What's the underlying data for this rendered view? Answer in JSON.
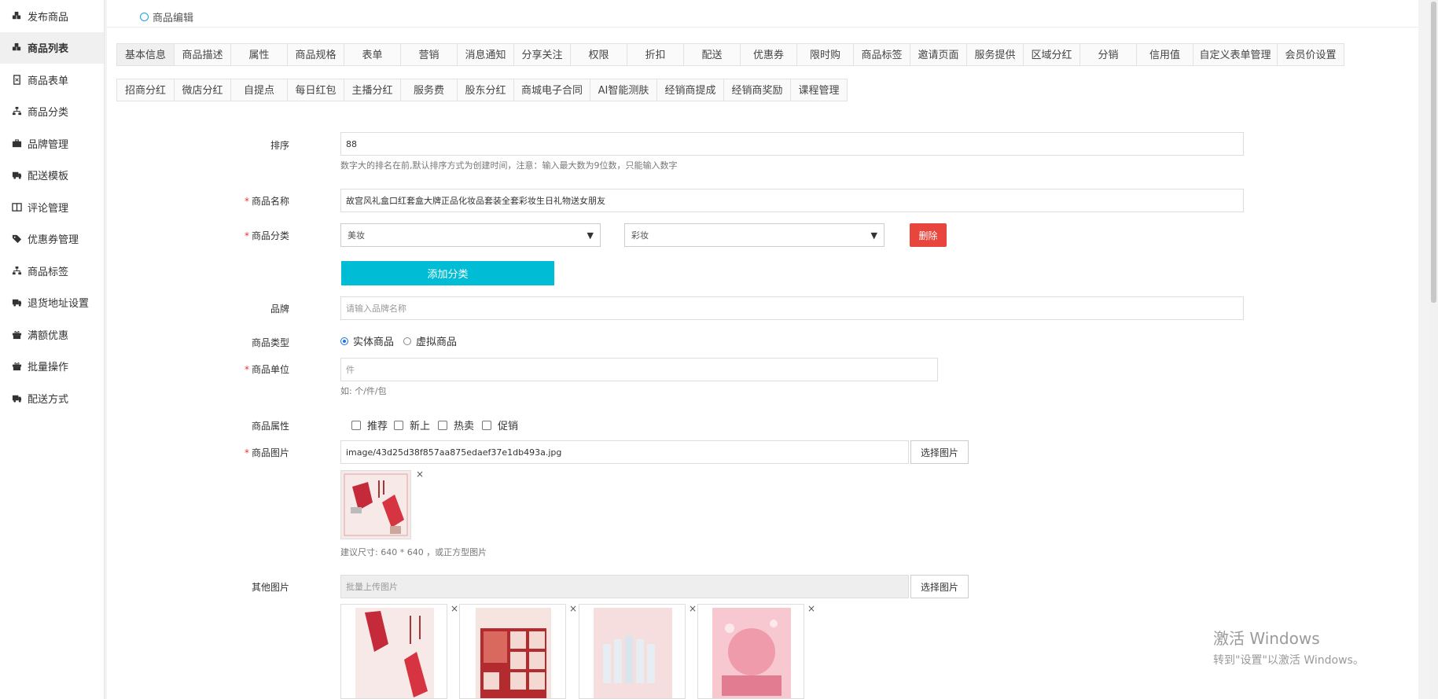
{
  "sidebar": {
    "items": [
      {
        "label": "发布商品",
        "icon": "cubes-icon"
      },
      {
        "label": "商品列表",
        "icon": "cubes-icon",
        "active": true
      },
      {
        "label": "商品表单",
        "icon": "file-icon"
      },
      {
        "label": "商品分类",
        "icon": "sitemap-icon"
      },
      {
        "label": "品牌管理",
        "icon": "briefcase-icon"
      },
      {
        "label": "配送模板",
        "icon": "truck-icon"
      },
      {
        "label": "评论管理",
        "icon": "columns-icon"
      },
      {
        "label": "优惠券管理",
        "icon": "tags-icon"
      },
      {
        "label": "商品标签",
        "icon": "sitemap-icon"
      },
      {
        "label": "退货地址设置",
        "icon": "truck-icon"
      },
      {
        "label": "满额优惠",
        "icon": "gift-icon"
      },
      {
        "label": "批量操作",
        "icon": "gift-icon"
      },
      {
        "label": "配送方式",
        "icon": "truck-icon"
      }
    ]
  },
  "breadcrumb": "商品编辑",
  "tabs_row1": [
    "基本信息",
    "商品描述",
    "属性",
    "商品规格",
    "表单",
    "营销",
    "消息通知",
    "分享关注",
    "权限",
    "折扣",
    "配送",
    "优惠券",
    "限时购",
    "商品标签",
    "邀请页面",
    "服务提供",
    "区域分红",
    "分销",
    "信用值",
    "自定义表单管理",
    "会员价设置"
  ],
  "tabs_row2": [
    "招商分红",
    "微店分红",
    "自提点",
    "每日红包",
    "主播分红",
    "服务费",
    "股东分红",
    "商城电子合同",
    "AI智能测肤",
    "经销商提成",
    "经销商奖励",
    "课程管理"
  ],
  "form": {
    "sort_label": "排序",
    "sort_value": "88",
    "sort_help": "数字大的排名在前,默认排序方式为创建时间，注意：输入最大数为9位数，只能输入数字",
    "name_label": "商品名称",
    "name_value": "故宫风礼盒口红套盒大牌正品化妆品套装全套彩妆生日礼物送女朋友",
    "category_label": "商品分类",
    "category_1": "美妆",
    "category_2": "彩妆",
    "delete_label": "删除",
    "add_category_label": "添加分类",
    "brand_label": "品牌",
    "brand_placeholder": "请输入品牌名称",
    "type_label": "商品类型",
    "type_physical": "实体商品",
    "type_virtual": "虚拟商品",
    "unit_label": "商品单位",
    "unit_placeholder": "件",
    "unit_help": "如: 个/件/包",
    "attr_label": "商品属性",
    "attr_recommend": "推荐",
    "attr_new": "新上",
    "attr_hot": "热卖",
    "attr_promo": "促销",
    "image_label": "商品图片",
    "image_value": "image/43d25d38f857aa875edaef37e1db493a.jpg",
    "choose_image": "选择图片",
    "image_help": "建议尺寸: 640 * 640 ，或正方型图片",
    "other_label": "其他图片",
    "other_placeholder": "批量上传图片",
    "close_glyph": "×"
  },
  "watermark": {
    "line1": "激活 Windows",
    "line2": "转到\"设置\"以激活 Windows。"
  },
  "colors": {
    "accent": "#00bcd4",
    "danger": "#e8453c",
    "required": "#ee3333"
  }
}
